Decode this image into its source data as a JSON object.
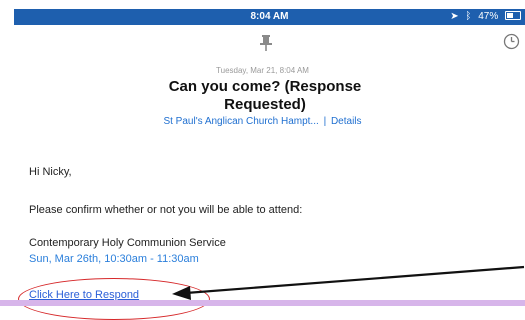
{
  "status_bar": {
    "time": "8:04 AM",
    "battery_percent": "47%"
  },
  "email": {
    "timestamp": "Tuesday, Mar 21, 8:04 AM",
    "subject_line1": "Can you come? (Response",
    "subject_line2": "Requested)",
    "sender": "St Paul's Anglican Church Hampt...",
    "separator": "|",
    "details_link": "Details",
    "greeting": "Hi Nicky,",
    "body": "Please confirm whether or not you will be able to attend:",
    "event_name": "Contemporary Holy Communion Service",
    "event_date": "Sun, Mar 26th, 10:30am - 11:30am",
    "respond_link": "Click Here to Respond"
  },
  "icons": {
    "pin": "pin-icon",
    "clock": "clock-icon",
    "location": "location-arrow-icon",
    "bluetooth": "bluetooth-icon",
    "battery": "battery-icon"
  },
  "colors": {
    "status_bar": "#1e5fae",
    "link": "#2b7fdb",
    "annotation": "#d6282a",
    "bottom_band": "#d7b5ea"
  }
}
